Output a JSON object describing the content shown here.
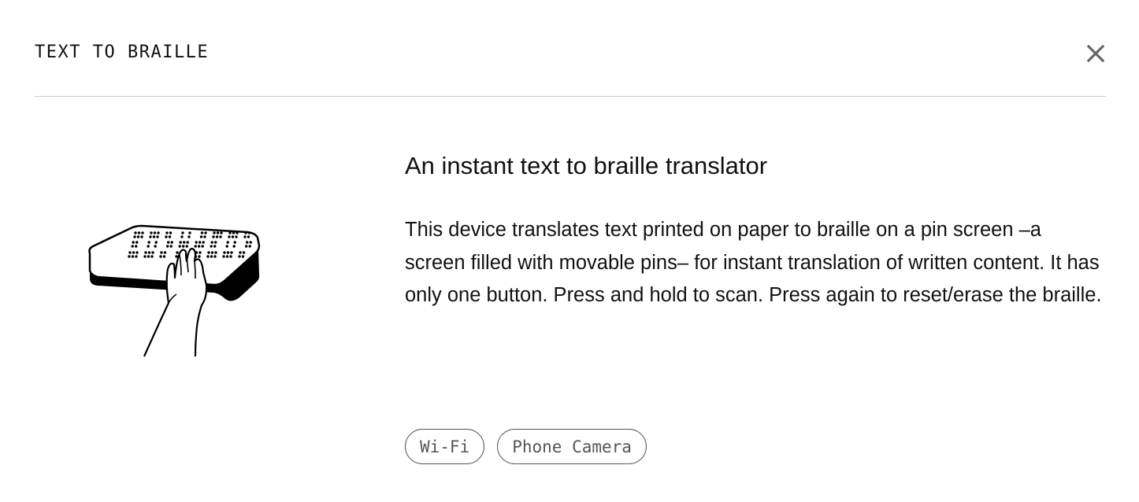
{
  "dialog": {
    "title": "TEXT TO BRAILLE",
    "close_icon": "close-icon"
  },
  "illustration": {
    "icon": "hand-on-braille-device-illustration"
  },
  "content": {
    "heading": "An instant text to braille translator",
    "description": "This device translates text printed on paper to braille on a pin screen –a screen filled with movable pins– for instant translation of written content. It has only one button. Press and hold to scan. Press again to reset/erase the braille."
  },
  "tags": [
    {
      "label": "Wi-Fi"
    },
    {
      "label": "Phone Camera"
    }
  ],
  "colors": {
    "text": "#111111",
    "divider": "#cfcfcf",
    "tag_border": "#555555",
    "close_icon": "#666666"
  }
}
